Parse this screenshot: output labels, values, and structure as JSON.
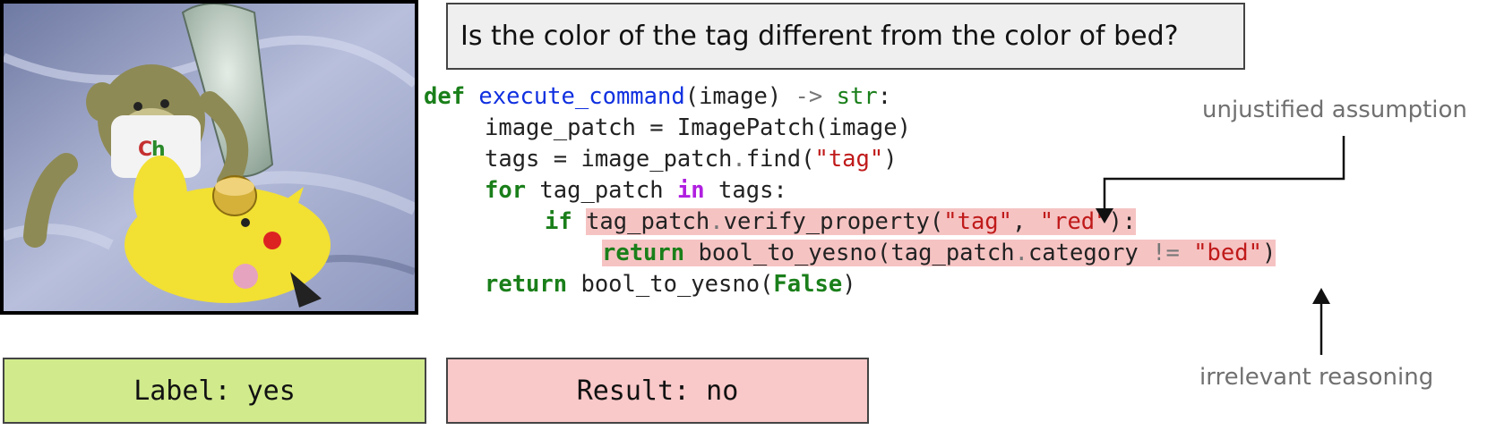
{
  "question": "Is the color of the tag different from the color of bed?",
  "code": {
    "l1_def": "def",
    "l1_fn": "execute_command",
    "l1_args": "(image) ",
    "l1_arrow": "->",
    "l1_type": "str",
    "l1_colon": ":",
    "l2": "image_patch = ImagePatch(image)",
    "l3_a": "tags = image_patch",
    "l3_dot": ".",
    "l3_b": "find(",
    "l3_str": "\"tag\"",
    "l3_c": ")",
    "l4_for": "for",
    "l4_a": " tag_patch ",
    "l4_in": "in",
    "l4_b": " tags:",
    "l5_if": "if",
    "l5_a": "tag_patch",
    "l5_dot": ".",
    "l5_b": "verify_property(",
    "l5_s1": "\"tag\"",
    "l5_c": ", ",
    "l5_s2": "\"red\"",
    "l5_d": "):",
    "l6_ret": "return",
    "l6_a": " bool_to_yesno(tag_patch",
    "l6_dot": ".",
    "l6_b": "category ",
    "l6_op": "!=",
    "l6_c": " ",
    "l6_s": "\"bed\"",
    "l6_d": ")",
    "l7_ret": "return",
    "l7_a": " bool_to_yesno(",
    "l7_false": "False",
    "l7_b": ")"
  },
  "annotations": {
    "top": "unjustified assumption",
    "bottom": "irrelevant reasoning"
  },
  "label_box": "Label: yes",
  "result_box": "Result: no",
  "colors": {
    "label_bg": "#d0ea8c",
    "result_bg": "#f9c8c8",
    "highlight": "#f6c3c3",
    "keyword": "#1a7f1a",
    "function": "#1030e0",
    "string": "#c01a1a"
  }
}
